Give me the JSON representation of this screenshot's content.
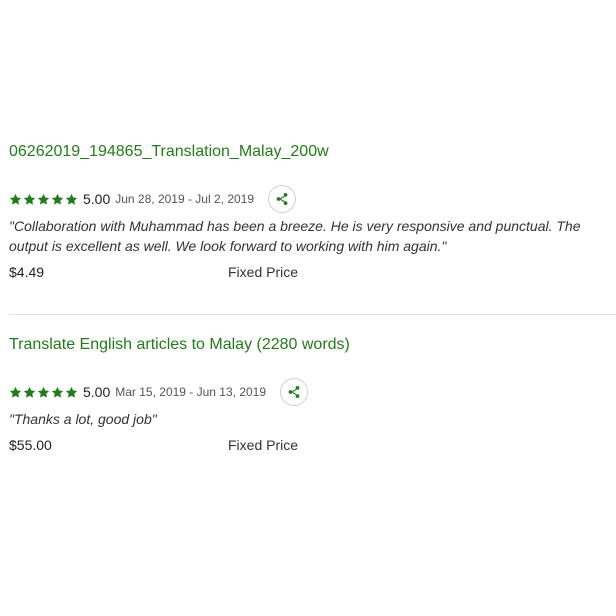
{
  "jobs": [
    {
      "title": "06262019_194865_Translation_Malay_200w",
      "score": "5.00",
      "dates": "Jun 28, 2019 - Jul 2, 2019",
      "feedback": "\"Collaboration with Muhammad has been a breeze. He is very responsive and punctual. The output is excellent as well. We look forward to working with him again.\"",
      "price": "$4.49",
      "price_type": "Fixed Price",
      "stars": 5
    },
    {
      "title": "Translate English articles to Malay (2280 words)",
      "score": "5.00",
      "dates": "Mar 15, 2019 - Jun 13, 2019",
      "feedback": "\"Thanks a lot, good job\"",
      "price": "$55.00",
      "price_type": "Fixed Price",
      "stars": 5
    }
  ],
  "colors": {
    "accent": "#1f7f16",
    "divider": "#e0e0e0"
  },
  "icons": {
    "star": "star-icon",
    "share": "share-icon"
  }
}
